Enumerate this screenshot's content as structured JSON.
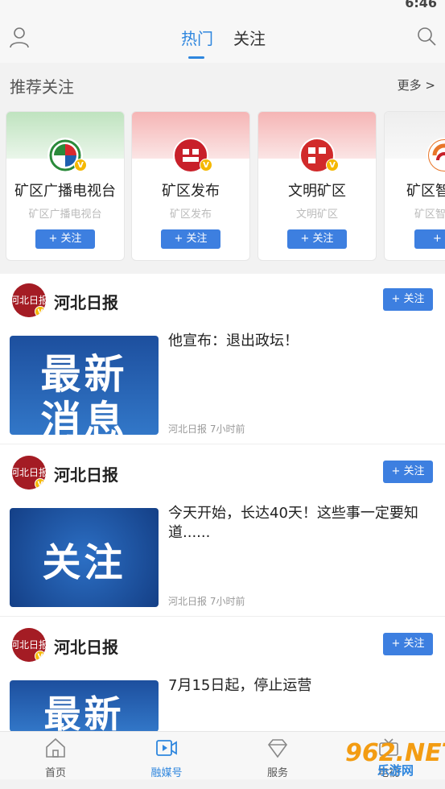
{
  "status": {
    "time": "6:46",
    "icons": [
      "wifi-icon",
      "no-sim-icon",
      "battery-icon"
    ]
  },
  "header": {
    "tabs": [
      {
        "label": "热门",
        "active": true
      },
      {
        "label": "关注",
        "active": false
      }
    ]
  },
  "recommend": {
    "title": "推荐关注",
    "more": "更多 >",
    "cards": [
      {
        "name": "矿区广播电视台",
        "sub": "矿区广播电视台",
        "button": "+ 关注",
        "banner": "#cfe9cf"
      },
      {
        "name": "矿区发布",
        "sub": "矿区发布",
        "button": "+ 关注",
        "banner": "#f7cccc"
      },
      {
        "name": "文明矿区",
        "sub": "文明矿区",
        "button": "+ 关注",
        "banner": "#f7cccc"
      },
      {
        "name": "矿区智",
        "sub": "矿区智",
        "button": "+ 关",
        "banner": "#f0f0f0"
      }
    ]
  },
  "posts": [
    {
      "author": "河北日报",
      "follow": "+ 关注",
      "title": "他宣布：退出政坛！",
      "meta": "河北日报  7小时前",
      "thumb_text": [
        "最新",
        "消息"
      ]
    },
    {
      "author": "河北日报",
      "follow": "+ 关注",
      "title": "今天开始，长达40天！这些事一定要知道......",
      "meta": "河北日报  7小时前",
      "thumb_text": [
        "关注"
      ]
    },
    {
      "author": "河北日报",
      "follow": "+ 关注",
      "title": "7月15日起，停止运营",
      "meta": "",
      "thumb_text": [
        "最新"
      ]
    }
  ],
  "bottom_nav": [
    {
      "label": "首页",
      "icon": "home-icon",
      "active": false
    },
    {
      "label": "融媒号",
      "icon": "media-icon",
      "active": true
    },
    {
      "label": "服务",
      "icon": "diamond-icon",
      "active": false
    },
    {
      "label": "电视",
      "icon": "tv-icon",
      "active": false
    }
  ],
  "watermark": {
    "number": "962.NET",
    "text": "乐游网"
  },
  "colors": {
    "accent": "#2e86de",
    "button": "#3d7fe0",
    "badge": "#f5b800",
    "brand_red": "#a41c24"
  }
}
